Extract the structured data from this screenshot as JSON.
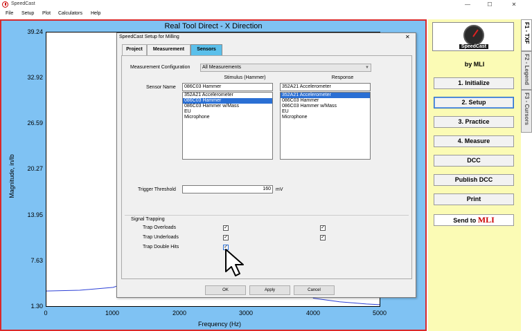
{
  "window": {
    "title": "SpeedCast",
    "minimize": "—",
    "maximize": "☐",
    "close": "✕"
  },
  "menu": [
    "File",
    "Setup",
    "Plot",
    "Calculators",
    "Help"
  ],
  "plot": {
    "title": "Real Tool Direct - X Direction",
    "ylabel": "Magnitude, in/lb",
    "xlabel": "Frequency (Hz)",
    "yticks": [
      "39.24",
      "32.92",
      "26.59",
      "20.27",
      "13.95",
      "7.63",
      "1.30"
    ],
    "xticks": [
      "0",
      "1000",
      "2000",
      "3000",
      "4000",
      "5000"
    ]
  },
  "chart_data": {
    "type": "line",
    "xlabel": "Frequency (Hz)",
    "ylabel": "Magnitude, in/lb",
    "title": "Real Tool Direct - X Direction",
    "xlim": [
      0,
      5000
    ],
    "ylim": [
      1.3,
      39.24
    ],
    "series": [
      {
        "x": [
          0,
          500,
          1000,
          1100
        ],
        "y": [
          3.4,
          3.5,
          3.9,
          4.2
        ]
      },
      {
        "x": [
          4000,
          4400,
          4800,
          5000
        ],
        "y": [
          2.4,
          1.9,
          1.6,
          1.5
        ]
      }
    ]
  },
  "sidebar": {
    "logo_text": "SpeedCast",
    "by": "by MLI",
    "buttons": [
      "1. Initialize",
      "2. Setup",
      "3. Practice",
      "4. Measure",
      "DCC",
      "Publish DCC",
      "Print"
    ],
    "send_label": "Send to",
    "send_brand": "MLI",
    "tabs": [
      "F1 - TXF",
      "F2 - Legend",
      "F3 - Cursors"
    ]
  },
  "dialog": {
    "title": "SpeedCast Setup for Milling",
    "close": "✕",
    "tabs": [
      "Project",
      "Measurement",
      "Sensors"
    ],
    "config_label": "Measurement Configuration",
    "config_value": "All Measurements",
    "stimulus_header": "Stimulus (Hammer)",
    "response_header": "Response",
    "sensor_name_label": "Sensor Name",
    "stimulus_value": "086C03 Hammer",
    "response_value": "352A21 Accelerometer",
    "sensor_options": [
      "352A21 Accelerometer",
      "086C03 Hammer",
      "086C03 Hammer w/Mass",
      "EU",
      "Microphone"
    ],
    "stimulus_selected": 1,
    "response_selected": 0,
    "trigger_label": "Trigger Threshold",
    "trigger_value": "160",
    "trigger_unit": "mV",
    "signal_trapping": "Signal Trapping",
    "trap_labels": [
      "Trap Overloads",
      "Trap Underloads",
      "Trap Double Hits"
    ],
    "check": "✓",
    "buttons": [
      "OK",
      "Apply",
      "Cancel"
    ]
  }
}
